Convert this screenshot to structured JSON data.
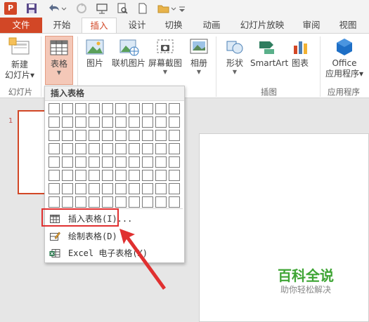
{
  "app": {
    "logo_letter": "P"
  },
  "tabs": [
    {
      "label": "文件",
      "active": false
    },
    {
      "label": "开始",
      "active": false
    },
    {
      "label": "插入",
      "active": true
    },
    {
      "label": "设计",
      "active": false
    },
    {
      "label": "切换",
      "active": false
    },
    {
      "label": "动画",
      "active": false
    },
    {
      "label": "幻灯片放映",
      "active": false
    },
    {
      "label": "审阅",
      "active": false
    },
    {
      "label": "视图",
      "active": false
    }
  ],
  "ribbon": {
    "new_slide": {
      "line1": "新建",
      "line2": "幻灯片"
    },
    "table": {
      "label": "表格"
    },
    "picture": {
      "label": "图片"
    },
    "online_picture": {
      "label": "联机图片"
    },
    "screenshot": {
      "label": "屏幕截图"
    },
    "album": {
      "label": "相册"
    },
    "shapes": {
      "label": "形状"
    },
    "smartart": {
      "label": "SmartArt"
    },
    "chart": {
      "label": "图表"
    },
    "office_apps": {
      "line1": "Office",
      "line2": "应用程序"
    },
    "groups": {
      "slides": "幻灯片",
      "illustrations": "插图",
      "apps": "应用程序"
    }
  },
  "table_dropdown": {
    "title": "插入表格",
    "grid": {
      "cols": 10,
      "rows": 8
    },
    "items": [
      {
        "label": "插入表格(I)...",
        "icon": "insert-table-icon"
      },
      {
        "label": "绘制表格(D)",
        "icon": "draw-table-icon"
      },
      {
        "label": "Excel 电子表格(X)",
        "icon": "excel-icon"
      }
    ]
  },
  "thumbnail": {
    "number": "1"
  },
  "watermark": {
    "title": "百科全说",
    "subtitle": "助你轻松解决"
  },
  "colors": {
    "accent": "#d24726",
    "pressed": "#f4c8b8",
    "highlight": "#e03030",
    "watermark_green": "#3fa535"
  }
}
